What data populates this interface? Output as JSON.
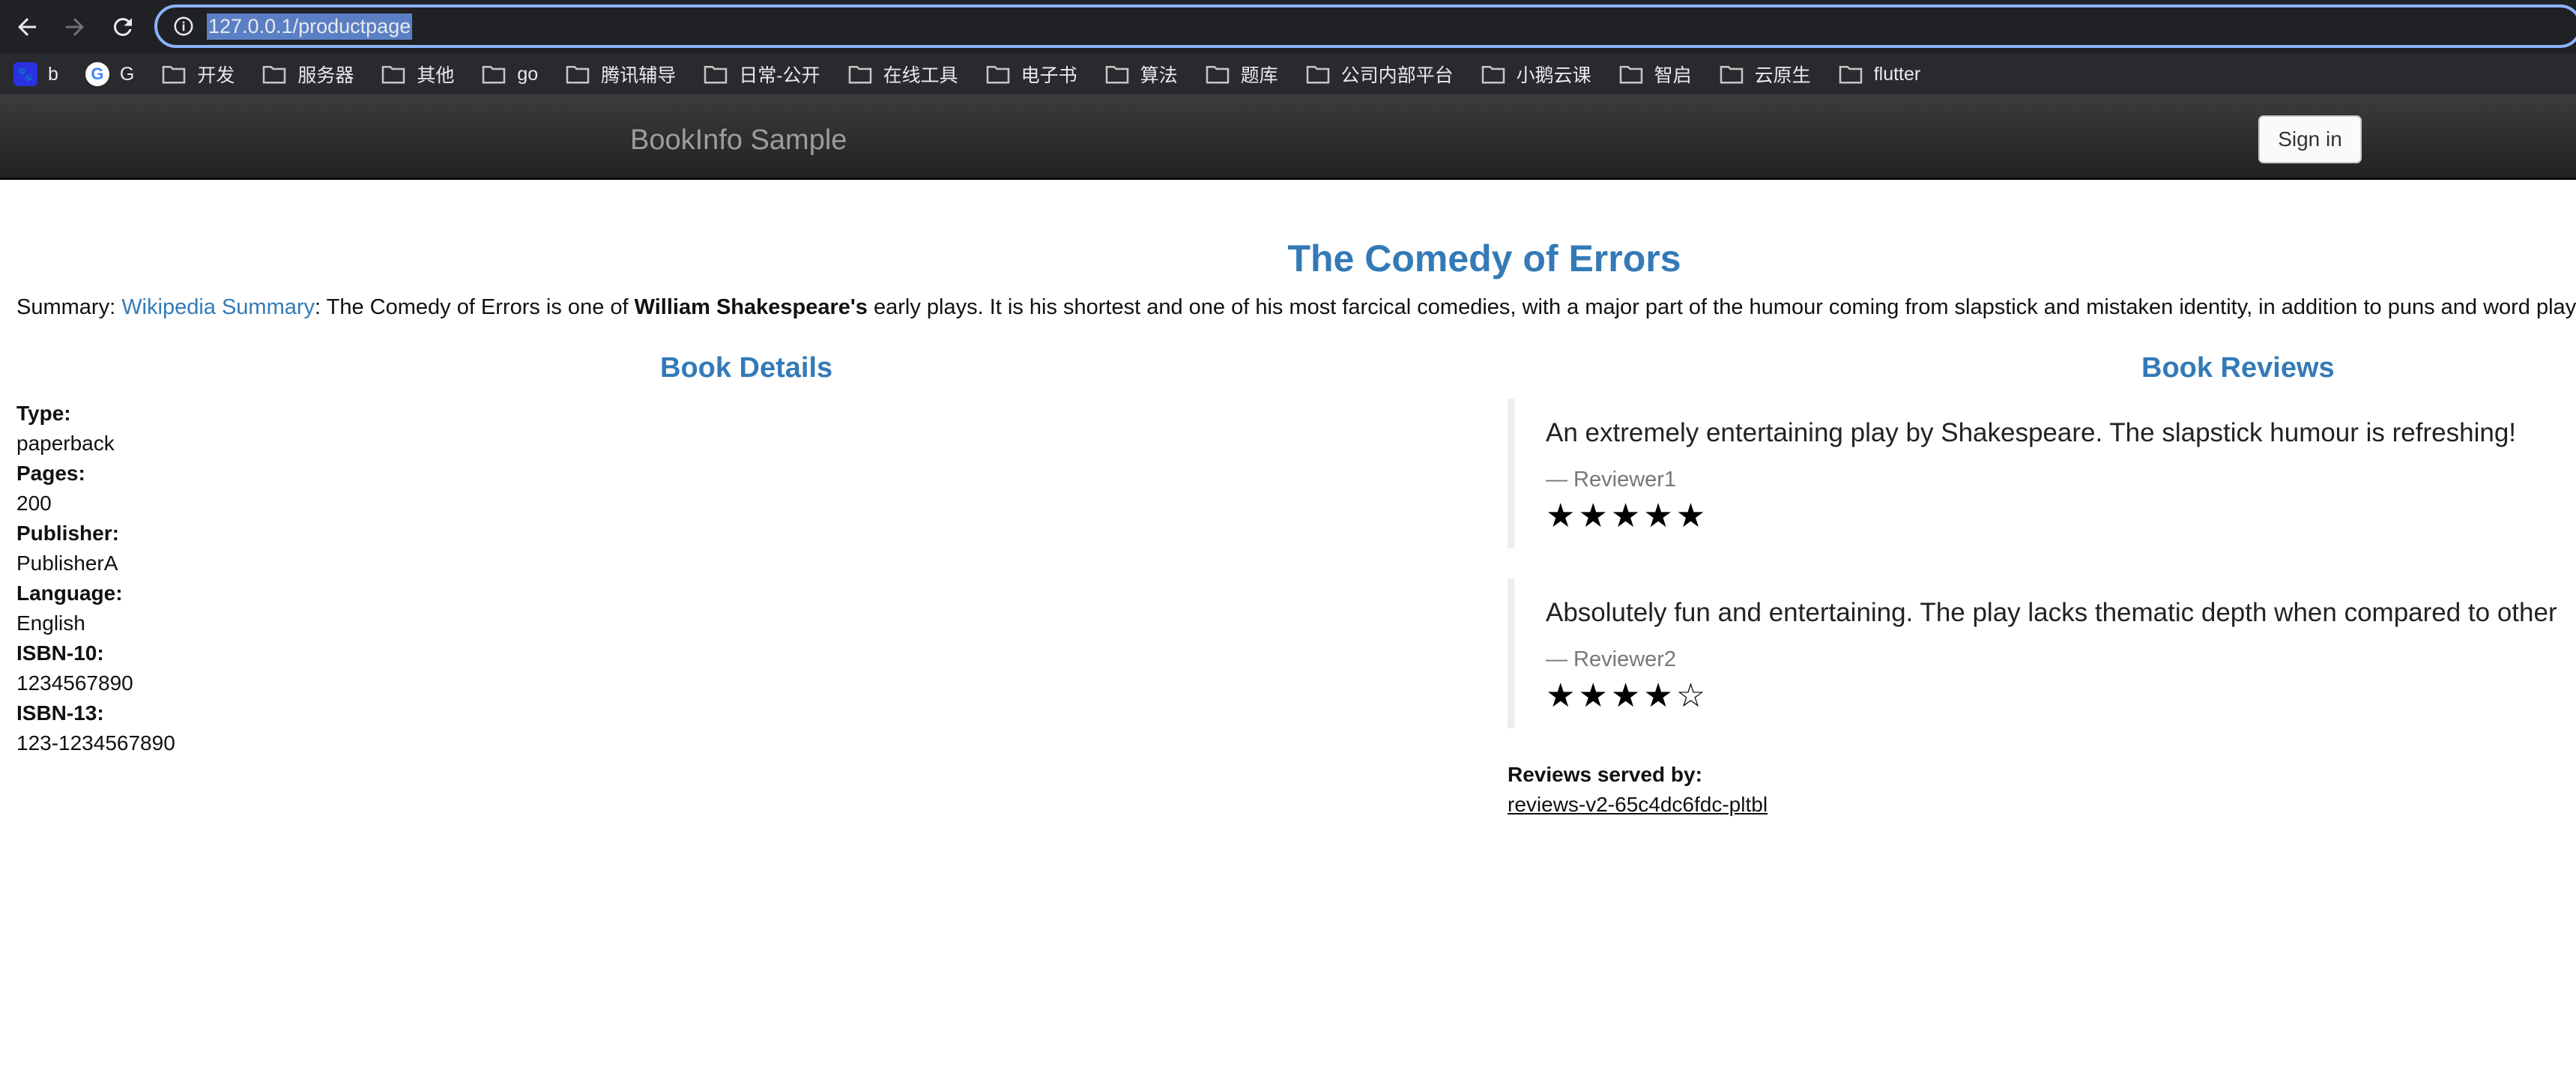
{
  "browser": {
    "url": "127.0.0.1/productpage",
    "bookmarks": [
      {
        "label": "b",
        "type": "favicon-baidu"
      },
      {
        "label": "G",
        "type": "favicon-google"
      },
      {
        "label": "开发",
        "type": "folder"
      },
      {
        "label": "服务器",
        "type": "folder"
      },
      {
        "label": "其他",
        "type": "folder"
      },
      {
        "label": "go",
        "type": "folder"
      },
      {
        "label": "腾讯辅导",
        "type": "folder"
      },
      {
        "label": "日常-公开",
        "type": "folder"
      },
      {
        "label": "在线工具",
        "type": "folder"
      },
      {
        "label": "电子书",
        "type": "folder"
      },
      {
        "label": "算法",
        "type": "folder"
      },
      {
        "label": "题库",
        "type": "folder"
      },
      {
        "label": "公司内部平台",
        "type": "folder"
      },
      {
        "label": "小鹅云课",
        "type": "folder"
      },
      {
        "label": "智启",
        "type": "folder"
      },
      {
        "label": "云原生",
        "type": "folder"
      },
      {
        "label": "flutter",
        "type": "folder"
      }
    ]
  },
  "navbar": {
    "brand": "BookInfo Sample",
    "signin_label": "Sign in"
  },
  "book": {
    "title": "The Comedy of Errors",
    "summary_prefix": "Summary: ",
    "summary_link": "Wikipedia Summary",
    "summary_mid": ": The Comedy of Errors is one of ",
    "summary_bold": "William Shakespeare's",
    "summary_rest": " early plays. It is his shortest and one of his most farcical comedies, with a major part of the humour coming from slapstick and mistaken identity, in addition to puns and word play."
  },
  "details": {
    "heading": "Book Details",
    "type_label": "Type:",
    "type_value": "paperback",
    "pages_label": "Pages:",
    "pages_value": "200",
    "publisher_label": "Publisher:",
    "publisher_value": "PublisherA",
    "language_label": "Language:",
    "language_value": "English",
    "isbn10_label": "ISBN-10:",
    "isbn10_value": "1234567890",
    "isbn13_label": "ISBN-13:",
    "isbn13_value": "123-1234567890"
  },
  "reviews": {
    "heading": "Book Reviews",
    "items": [
      {
        "text": "An extremely entertaining play by Shakespeare. The slapstick humour is refreshing!",
        "reviewer": "— Reviewer1",
        "stars": "★★★★★",
        "rating": 5
      },
      {
        "text": "Absolutely fun and entertaining. The play lacks thematic depth when compared to other",
        "reviewer": "— Reviewer2",
        "stars": "★★★★☆",
        "rating": 4
      }
    ],
    "served_label": "Reviews served by:",
    "served_value": "reviews-v2-65c4dc6fdc-pltbl"
  },
  "colors": {
    "accent": "#337ab7",
    "toolbar": "#202124",
    "omnibox_border": "#8ab4f8"
  }
}
